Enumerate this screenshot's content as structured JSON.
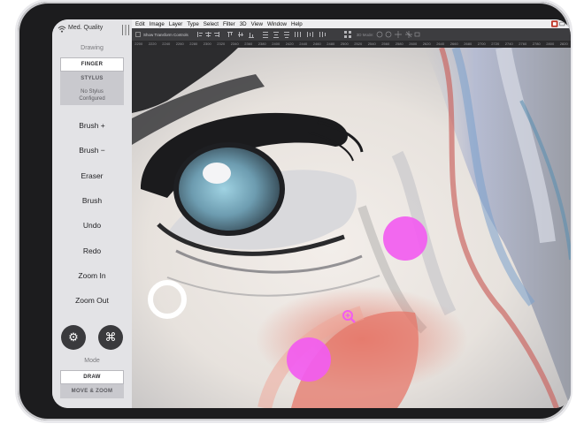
{
  "panel": {
    "quality": "Med. Quality",
    "drawing_label": "Drawing",
    "input_modes": [
      "FINGER",
      "STYLUS"
    ],
    "stylus_note": [
      "No Stylus",
      "Configured"
    ],
    "commands": [
      "Brush +",
      "Brush −",
      "Eraser",
      "Brush",
      "Undo",
      "Redo",
      "Zoom In",
      "Zoom Out"
    ],
    "mode_label": "Mode",
    "modes": [
      "DRAW",
      "MOVE & ZOOM"
    ]
  },
  "menu": [
    "Edit",
    "Image",
    "Layer",
    "Type",
    "Select",
    "Filter",
    "3D",
    "View",
    "Window",
    "Help"
  ],
  "options_bar": {
    "transform_label": "Show Transform Controls",
    "mode_3d": "3D Mode:"
  },
  "ruler_ticks": [
    "2200",
    "2220",
    "2240",
    "2260",
    "2280",
    "2300",
    "2320",
    "2340",
    "2360",
    "2380",
    "2400",
    "2420",
    "2440",
    "2460",
    "2480",
    "2500",
    "2520",
    "2540",
    "2560",
    "2580",
    "2600",
    "2620",
    "2640",
    "2660",
    "2680",
    "2700",
    "2720",
    "2740",
    "2760",
    "2780",
    "2800",
    "2820"
  ],
  "colors": {
    "touch_marker": "#f25cf0",
    "panel_bg": "#e3e3e6",
    "device": "#1c1c1e"
  },
  "icons": [
    "wifi-icon",
    "grip-icon",
    "gear-icon",
    "command-icon",
    "zoom-in-icon"
  ]
}
